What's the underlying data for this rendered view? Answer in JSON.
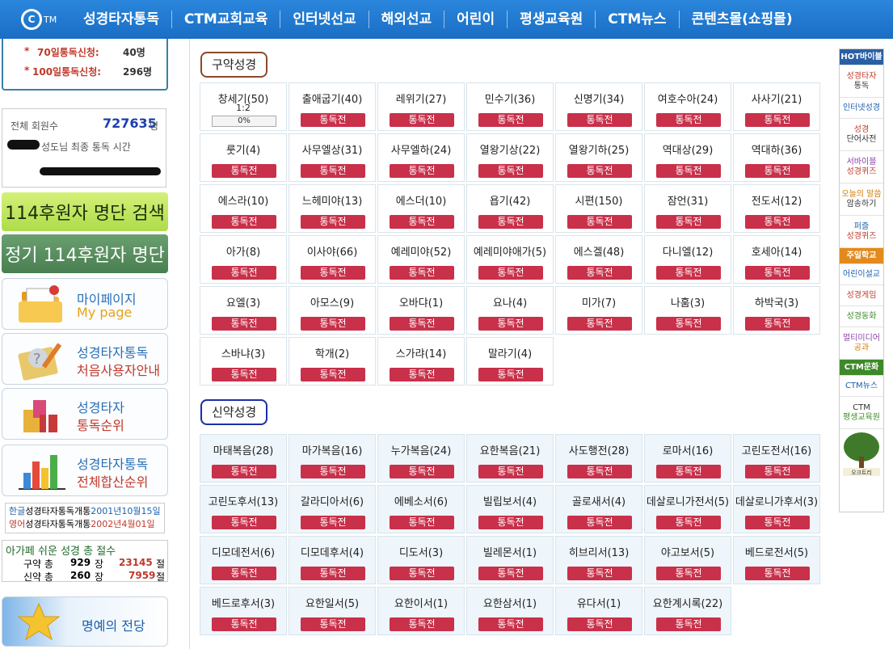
{
  "nav": {
    "logo_text": "C",
    "logo_sub": "TM",
    "items": [
      "성경타자통독",
      "CTM교회교육",
      "인터넷선교",
      "해외선교",
      "어린이",
      "평생교육원",
      "CTM뉴스",
      "콘텐츠몰(쇼핑몰)"
    ]
  },
  "left": {
    "stats70_label": "70일통독신청:",
    "stats70_value": "40명",
    "stats100_label": "100일통독신청:",
    "stats100_value": "296명",
    "members_label": "전체 회원수",
    "members_value": "727635",
    "members_unit": "명",
    "last_read_label": "성도님 최종 통독 시간",
    "search114": "114후원자 명단 검색",
    "list114": "정기 114후원자 명단",
    "mypage_t1": "마이페이지",
    "mypage_t2": "My page",
    "guide_t1": "성경타자통독",
    "guide_t2": "처음사용자안내",
    "rank_t1": "성경타자",
    "rank_t2": "통독순위",
    "total_t1": "성경타자통독",
    "total_t2": "전체합산순위",
    "open_ko_label": "한글",
    "open_ko_text": "성경타자통독개통",
    "open_ko_date": "2001년10월15일",
    "open_en_label": "영어",
    "open_en_text": "성경타자통독개통",
    "open_en_date": "2002년4월01일",
    "count_title": "아가페 쉬운 성경 총 절수",
    "ot_label": "구약 총",
    "ot_chapters": "929",
    "ot_jang": "장",
    "ot_verses": "23145",
    "ot_jeol": "절",
    "nt_label": "신약 총",
    "nt_chapters": "260",
    "nt_jang": "장",
    "nt_verses": "7959",
    "nt_jeol": "절",
    "honor": "명예의 전당"
  },
  "main": {
    "ot_title": "구약성경",
    "nt_title": "신약성경",
    "button_label": "통독전",
    "genesis_ratio": "1:2",
    "genesis_progress": "0%",
    "genesis_progress_value": 0,
    "ot_books": [
      "창세기(50)",
      "출애굽기(40)",
      "레위기(27)",
      "민수기(36)",
      "신명기(34)",
      "여호수아(24)",
      "사사기(21)",
      "룻기(4)",
      "사무엘상(31)",
      "사무엘하(24)",
      "열왕기상(22)",
      "열왕기하(25)",
      "역대상(29)",
      "역대하(36)",
      "에스라(10)",
      "느헤미야(13)",
      "에스더(10)",
      "욥기(42)",
      "시편(150)",
      "잠언(31)",
      "전도서(12)",
      "아가(8)",
      "이사야(66)",
      "예레미야(52)",
      "예레미야애가(5)",
      "에스겔(48)",
      "다니엘(12)",
      "호세아(14)",
      "요엘(3)",
      "아모스(9)",
      "오바댜(1)",
      "요나(4)",
      "미가(7)",
      "나훔(3)",
      "하박국(3)",
      "스바냐(3)",
      "학개(2)",
      "스가랴(14)",
      "말라기(4)"
    ],
    "nt_books": [
      "마태복음(28)",
      "마가복음(16)",
      "누가복음(24)",
      "요한복음(21)",
      "사도행전(28)",
      "로마서(16)",
      "고린도전서(16)",
      "고린도후서(13)",
      "갈라디아서(6)",
      "에베소서(6)",
      "빌립보서(4)",
      "골로새서(4)",
      "데살로니가전서(5)",
      "데살로니가후서(3)",
      "디모데전서(6)",
      "디모데후서(4)",
      "디도서(3)",
      "빌레몬서(1)",
      "히브리서(13)",
      "야고보서(5)",
      "베드로전서(5)",
      "베드로후서(3)",
      "요한일서(5)",
      "요한이서(1)",
      "요한삼서(1)",
      "유다서(1)",
      "요한계시록(22)"
    ]
  },
  "right": {
    "hot": "HOT바이블",
    "b1a": "성경타자",
    "b1b": "통독",
    "b2": "인터넷성경",
    "b3a": "성경",
    "b3b": "단어사전",
    "b4a": "서바이블",
    "b4b": "성경퀴즈",
    "b5a": "오늘의 말씀",
    "b5b": "암송하기",
    "b6a": "퍼즐",
    "b6b": "성경퀴즈",
    "sunday": "주일학교",
    "b7": "어린이설교",
    "b8": "성경게임",
    "b9": "성경동화",
    "b10a": "멀티미디어",
    "b10b": "공과",
    "culture": "CTM문화",
    "b11": "CTM뉴스",
    "b12a": "CTM",
    "b12b": "평생교육원",
    "tree": "오크트리"
  },
  "colors": {
    "nav_bg": "#1f78d1",
    "button_red": "#c9304a",
    "ot_border": "#8b4a2b",
    "nt_border": "#1b2fa8"
  }
}
